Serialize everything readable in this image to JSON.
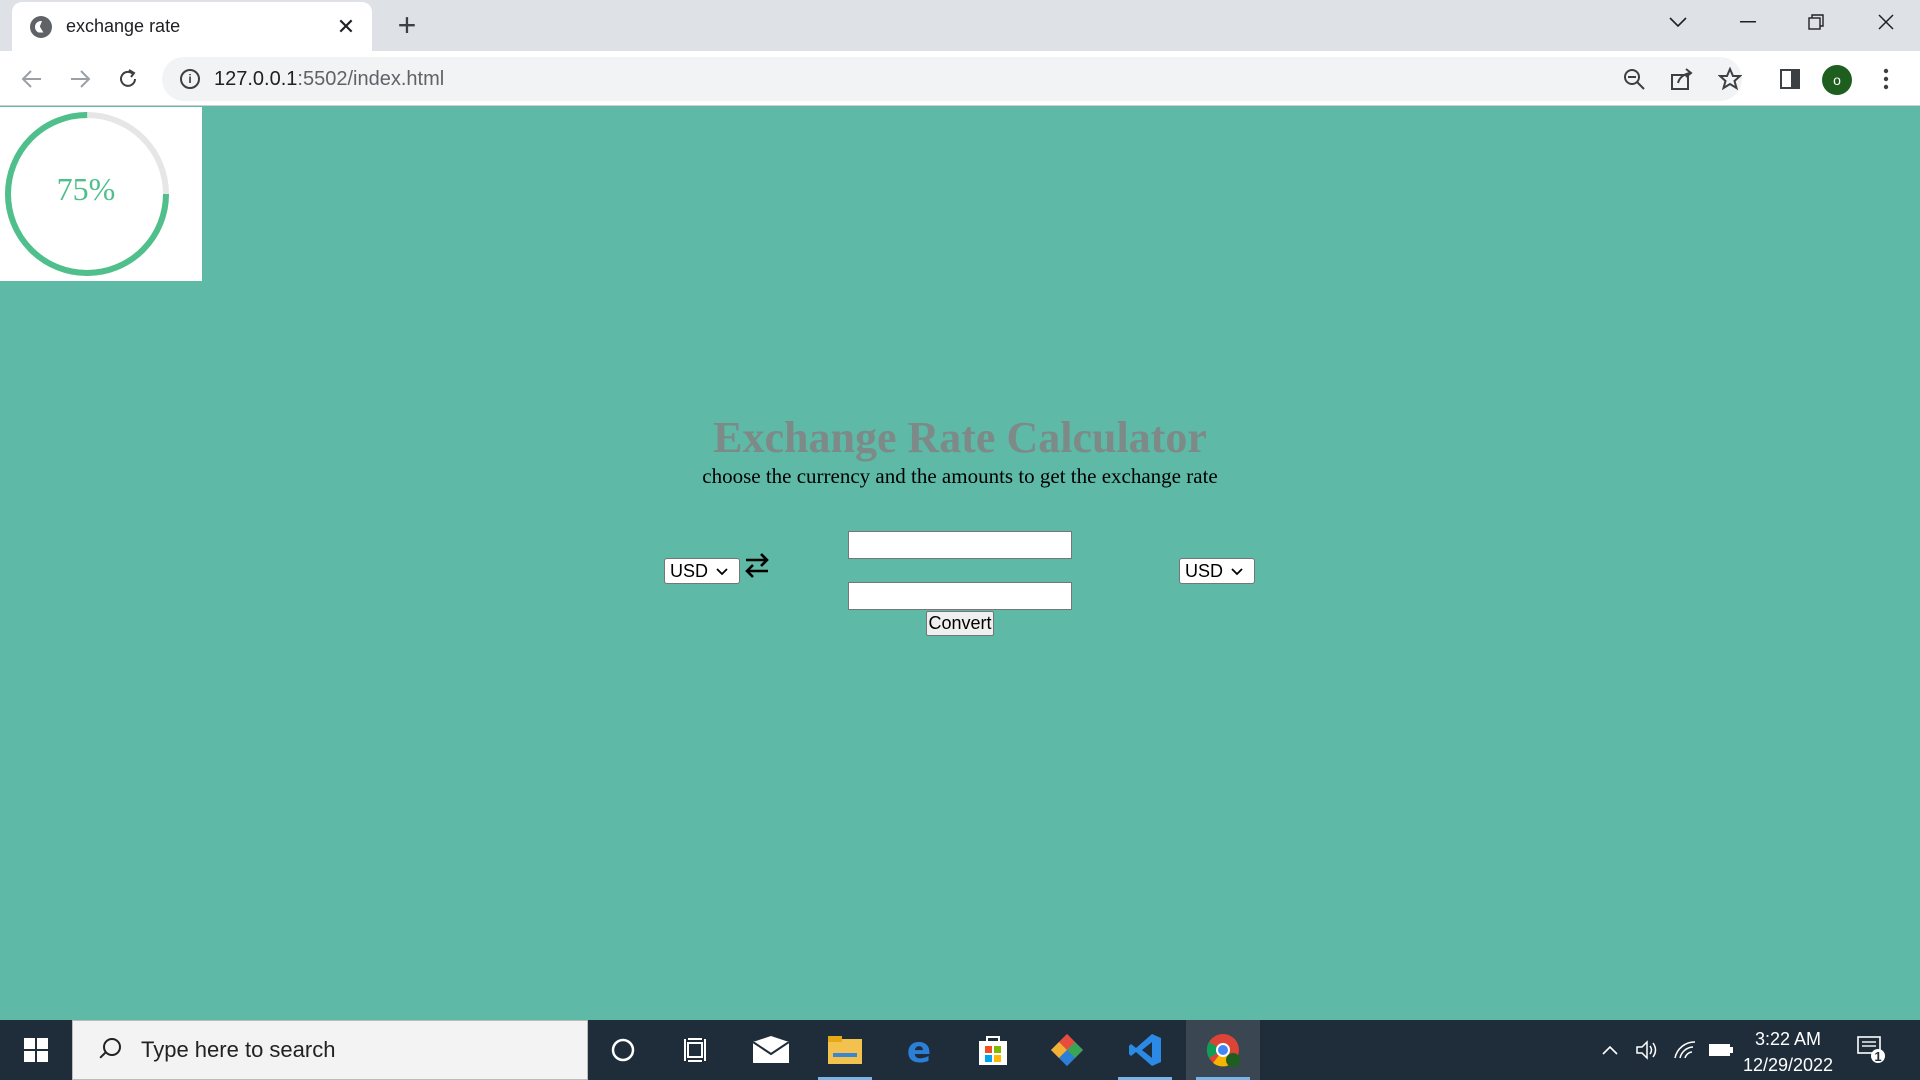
{
  "browser": {
    "tab_title": "exchange rate",
    "url_host": "127.0.0.1",
    "url_rest": ":5502/index.html",
    "profile_initial": "o"
  },
  "progress": {
    "label": "75%",
    "value": 0.75,
    "color": "#4fbf8c"
  },
  "page": {
    "title": "Exchange Rate Calculator",
    "subtitle": "choose the currency and the amounts to get the exchange rate",
    "from_currency": "USD",
    "to_currency": "USD",
    "amount_one": "",
    "amount_two": "",
    "convert_label": "Convert",
    "swap_icon": "swap-arrows-icon",
    "background": "#5eb9a6"
  },
  "taskbar": {
    "search_placeholder": "Type here to search",
    "time": "3:22 AM",
    "date": "12/29/2022",
    "notification_count": "1"
  }
}
